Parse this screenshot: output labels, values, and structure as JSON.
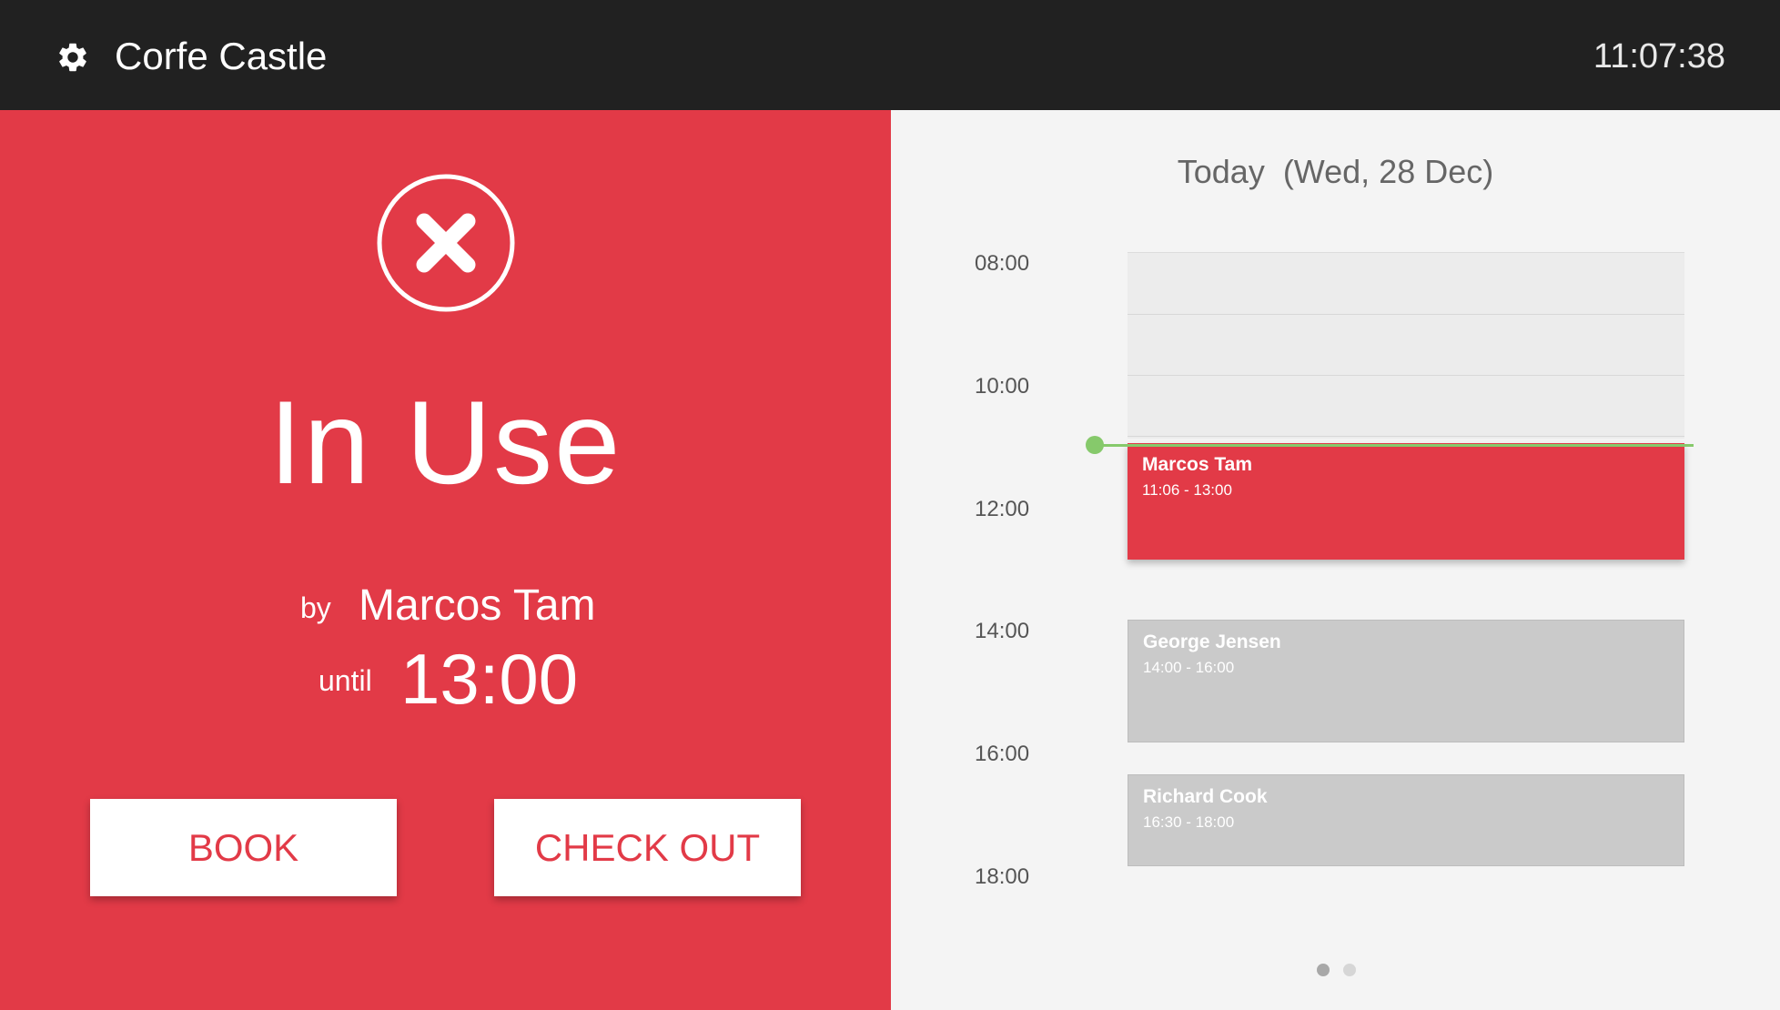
{
  "header": {
    "room_name": "Corfe Castle",
    "clock": "11:07:38",
    "settings_icon": "gear-icon"
  },
  "status": {
    "icon": "close-circle-icon",
    "label": "In Use",
    "by_label": "by",
    "organizer": "Marcos Tam",
    "until_label": "until",
    "until_time": "13:00",
    "color": "#e23a47"
  },
  "actions": {
    "book_label": "BOOK",
    "checkout_label": "CHECK OUT"
  },
  "schedule": {
    "date_header": "Today  (Wed, 28 Dec)",
    "time_labels": [
      "08:00",
      "10:00",
      "12:00",
      "14:00",
      "16:00",
      "18:00"
    ],
    "now_indicator_color": "#86c96b",
    "events": [
      {
        "name": "Marcos Tam",
        "time": "11:06 - 13:00",
        "state": "current"
      },
      {
        "name": "George Jensen",
        "time": "14:00 - 16:00",
        "state": "upcoming"
      },
      {
        "name": "Richard Cook",
        "time": "16:30 - 18:00",
        "state": "upcoming"
      }
    ],
    "pagination": {
      "pages": 2,
      "current": 1
    }
  }
}
